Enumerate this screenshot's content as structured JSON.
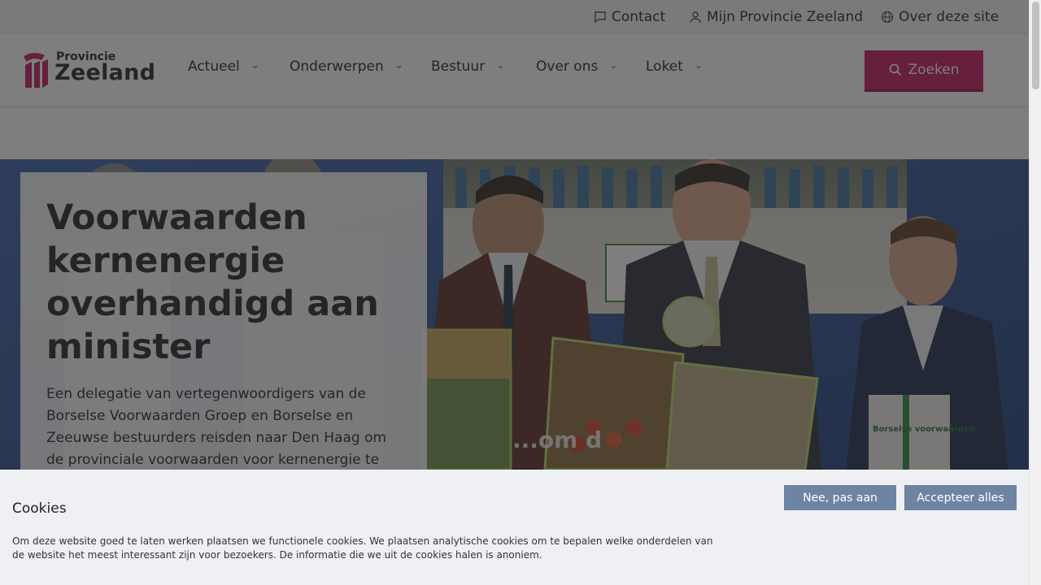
{
  "topbar": {
    "contact": "Contact",
    "mijn": "Mijn Provincie Zeeland",
    "over": "Over deze site"
  },
  "logo": {
    "small": "Provincie",
    "big": "Zeeland"
  },
  "nav": {
    "items": [
      "Actueel",
      "Onderwerpen",
      "Bestuur",
      "Over ons",
      "Loket"
    ]
  },
  "search": {
    "label": "Zoeken"
  },
  "hero": {
    "title": "Voorwaarden kernenergie overhandigd aan minister",
    "text": "Een delegatie van vertegenwoordigers van de Borselse Voorwaarden Groep en Borselse en Zeeuwse bestuurders reisden naar Den Haag om de provinciale voorwaarden voor kernenergie te overhandigen.",
    "sign_text": "Borselse voorwaarden",
    "puzzle_text": "...om d"
  },
  "cookie": {
    "title": "Cookies",
    "text": "Om deze website goed te laten werken plaatsen we functionele cookies. We plaatsen analytische cookies om te bepalen welke onderdelen van de website het meest interessant zijn voor bezoekers. De informatie die we uit de cookies halen is anoniem.",
    "btn_decline": "Nee, pas aan",
    "btn_accept": "Accepteer alles"
  },
  "colors": {
    "brand": "#c4125a",
    "cookie_btn": "#6e84a3"
  }
}
